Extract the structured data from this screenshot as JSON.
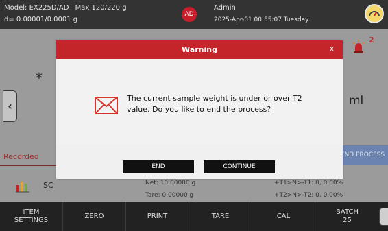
{
  "header": {
    "model": "Model: EX225D/AD",
    "max": "Max 120/220 g",
    "resolution": "d= 0.00001/0.0001 g",
    "avatar_initials": "AD",
    "user": "Admin",
    "datetime": "2025-Apr-01 00:55:07 Tuesday"
  },
  "main": {
    "asterisk": "*",
    "unit": "ml",
    "alarm_count": "2",
    "recorded_label": "Recorded",
    "end_process_label": "END PROCESS",
    "sample_name": "SC",
    "net_text": "Net: 10.00000 g",
    "tare_text": "Tare: 0.00000 g",
    "t1_text": "+T1>N>-T1: 0, 0.00%",
    "t2_text": "+T2>N>-T2: 0, 0.00%"
  },
  "toolbar": {
    "buttons": [
      {
        "line1": "ITEM",
        "line2": "SETTINGS"
      },
      {
        "line1": "ZERO",
        "line2": ""
      },
      {
        "line1": "PRINT",
        "line2": ""
      },
      {
        "line1": "TARE",
        "line2": ""
      },
      {
        "line1": "CAL",
        "line2": ""
      },
      {
        "line1": "BATCH",
        "line2": "25"
      }
    ]
  },
  "dialog": {
    "title": "Warning",
    "close": "X",
    "message_line1": "The current sample weight is under or over T2",
    "message_line2": "value. Do you like to end the process?",
    "end_label": "END",
    "continue_label": "CONTINUE"
  },
  "colors": {
    "header_red": "#c4252b",
    "topbar": "#333333",
    "end_process_blue": "#6a83b1"
  },
  "icons": [
    "gauge-icon",
    "alarm-icon",
    "chart-icon",
    "mail-icon",
    "chevron-left-icon",
    "chevron-right-icon"
  ]
}
